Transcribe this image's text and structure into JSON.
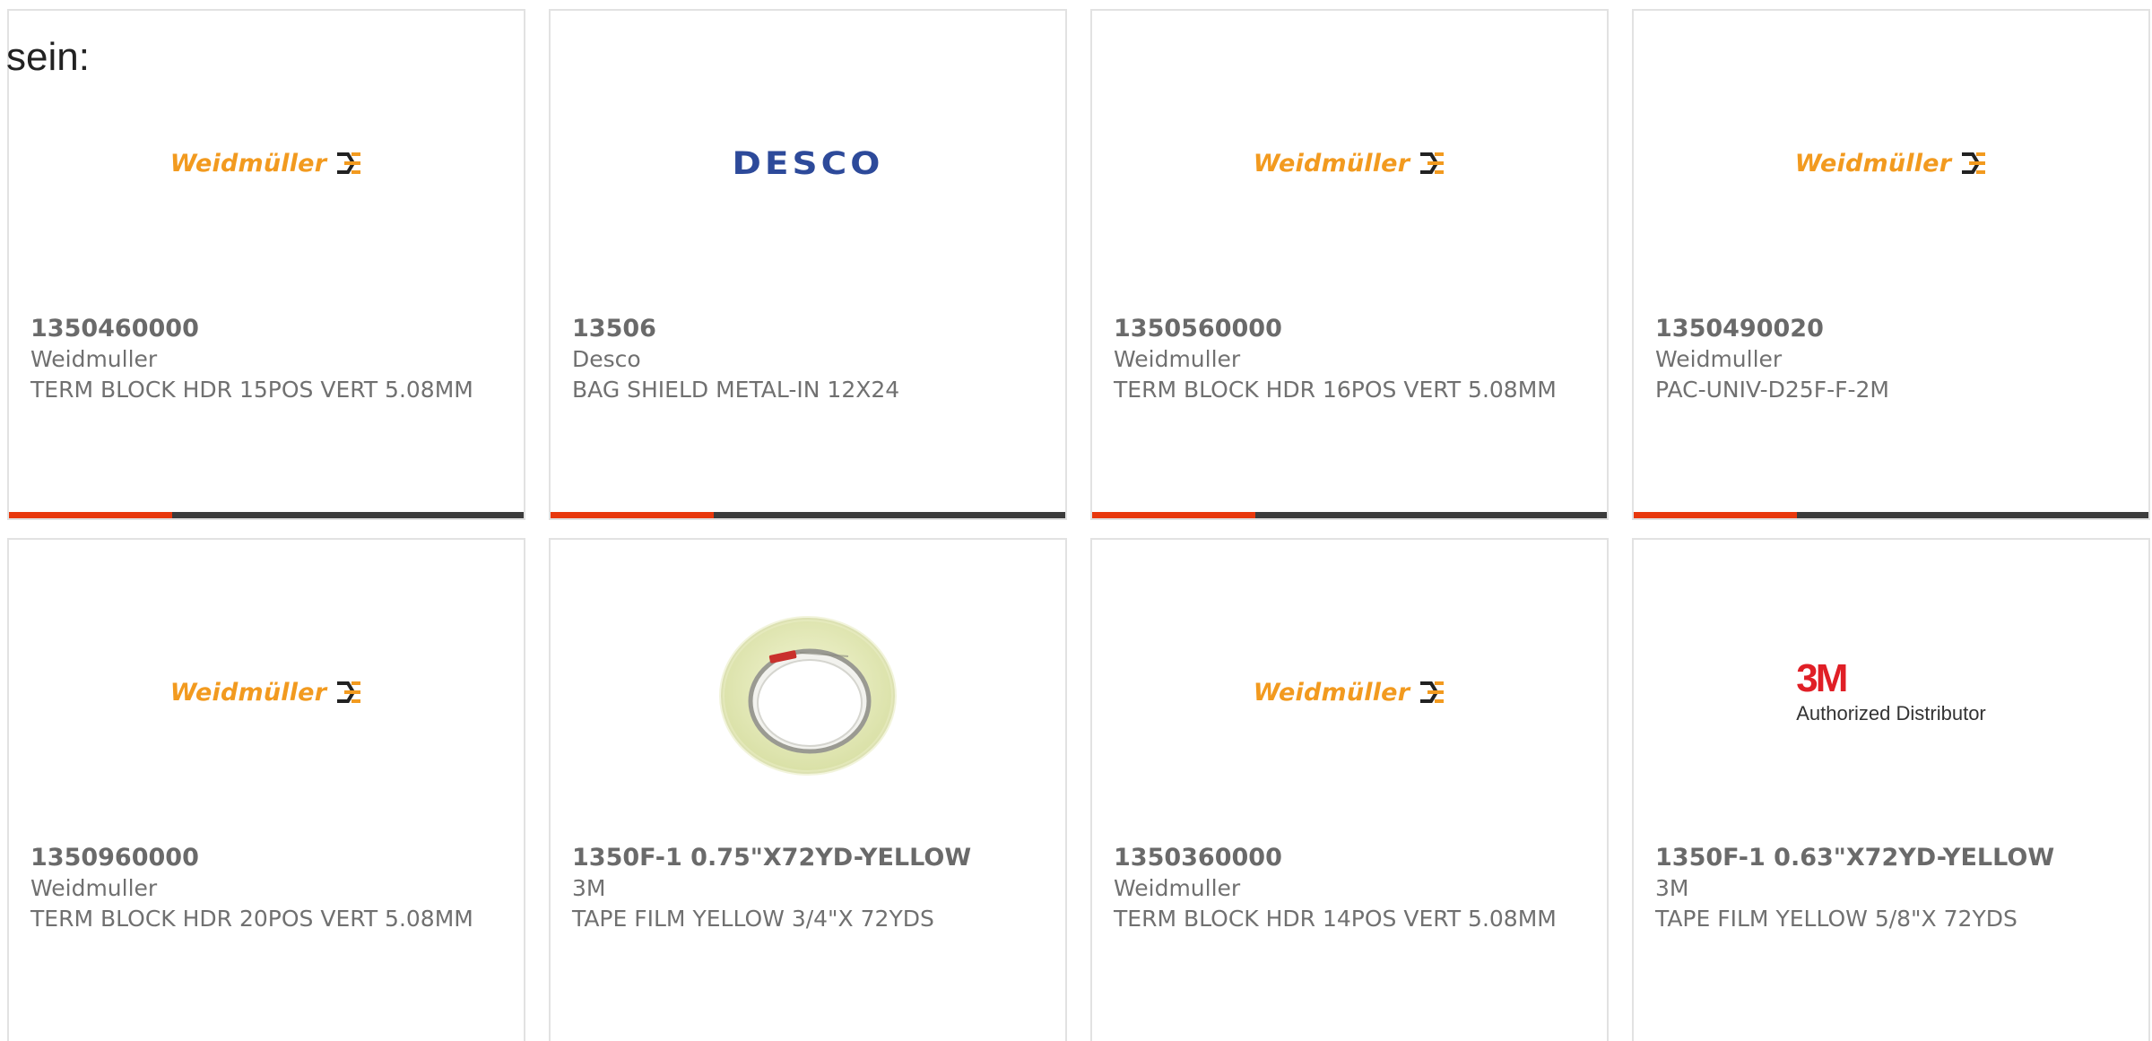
{
  "intro_text": "sein:",
  "colors": {
    "accent_red": "#e8380d",
    "bar_dark": "#3c3c3c",
    "weidmuller_orange": "#f29a1f",
    "desco_blue": "#2d4a9a",
    "threem_red": "#e01f26"
  },
  "products": [
    {
      "part_number": "1350460000",
      "manufacturer": "Weidmuller",
      "description": "TERM BLOCK HDR 15POS VERT 5.08MM",
      "logo_text": "Weidmüller",
      "image": "weidmuller-logo"
    },
    {
      "part_number": "13506",
      "manufacturer": "Desco",
      "description": "BAG SHIELD METAL-IN 12X24",
      "logo_text": "DESCO",
      "image": "desco-logo"
    },
    {
      "part_number": "1350560000",
      "manufacturer": "Weidmuller",
      "description": "TERM BLOCK HDR 16POS VERT 5.08MM",
      "logo_text": "Weidmüller",
      "image": "weidmuller-logo"
    },
    {
      "part_number": "1350490020",
      "manufacturer": "Weidmuller",
      "description": "PAC-UNIV-D25F-F-2M",
      "logo_text": "Weidmüller",
      "image": "weidmuller-logo"
    },
    {
      "part_number": "1350960000",
      "manufacturer": "Weidmuller",
      "description": "TERM BLOCK HDR 20POS VERT 5.08MM",
      "logo_text": "Weidmüller",
      "image": "weidmuller-logo"
    },
    {
      "part_number": "1350F-1 0.75\"X72YD-YELLOW",
      "manufacturer": "3M",
      "description": "TAPE FILM YELLOW 3/4\"X 72YDS",
      "image": "tape-roll-photo"
    },
    {
      "part_number": "1350360000",
      "manufacturer": "Weidmuller",
      "description": "TERM BLOCK HDR 14POS VERT 5.08MM",
      "logo_text": "Weidmüller",
      "image": "weidmuller-logo"
    },
    {
      "part_number": "1350F-1 0.63\"X72YD-YELLOW",
      "manufacturer": "3M",
      "description": "TAPE FILM YELLOW 5/8\"X 72YDS",
      "logo_text": "3M",
      "logo_subtext": "Authorized Distributor",
      "image": "3m-authorized-distributor-logo"
    }
  ]
}
